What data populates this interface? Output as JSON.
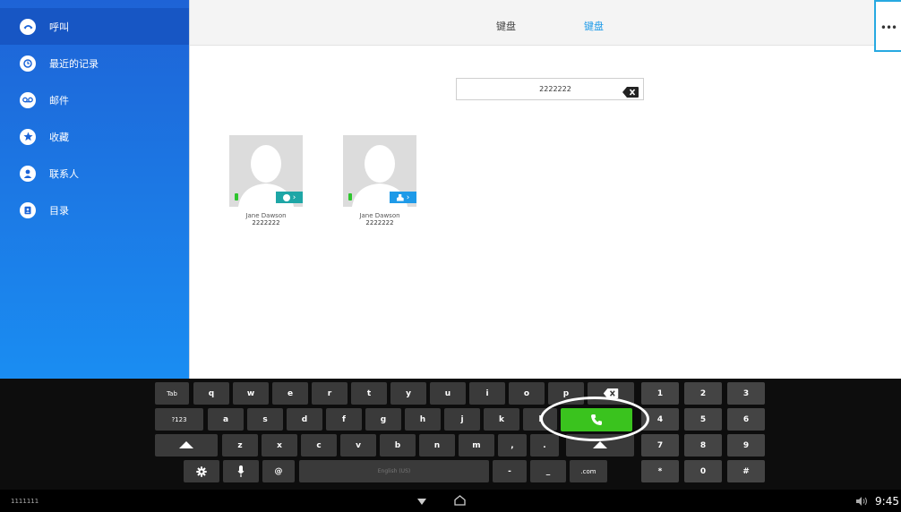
{
  "sidebar": {
    "items": [
      {
        "label": "呼叫",
        "icon": "phone-icon",
        "active": true
      },
      {
        "label": "最近的记录",
        "icon": "clock-icon"
      },
      {
        "label": "邮件",
        "icon": "voicemail-icon"
      },
      {
        "label": "收藏",
        "icon": "star-icon"
      },
      {
        "label": "联系人",
        "icon": "person-icon"
      },
      {
        "label": "目录",
        "icon": "directory-icon"
      }
    ]
  },
  "header": {
    "tabs": [
      {
        "label": "键盘"
      },
      {
        "label": "键盘",
        "active": true
      }
    ],
    "more_label": "•••",
    "accent_color": "#1e9ae8"
  },
  "search": {
    "value": "2222222"
  },
  "contacts": [
    {
      "name": "Jane Dawson",
      "number": "2222222",
      "action_icon": "video-icon"
    },
    {
      "name": "Jane Dawson",
      "number": "2222222",
      "action_icon": "contact-card-icon"
    }
  ],
  "keyboard": {
    "row1": [
      "Tab",
      "q",
      "w",
      "e",
      "r",
      "t",
      "y",
      "u",
      "i",
      "o",
      "p"
    ],
    "row2": [
      "?123",
      "a",
      "s",
      "d",
      "f",
      "g",
      "h",
      "j",
      "k",
      "l"
    ],
    "row3": [
      "z",
      "x",
      "c",
      "v",
      "b",
      "n",
      "m",
      ",",
      "."
    ],
    "row4": [
      "@",
      "English (US)",
      "-",
      "_",
      ".com"
    ],
    "call_color": "#3ac31e"
  },
  "numpad": {
    "keys": [
      "1",
      "2",
      "3",
      "4",
      "5",
      "6",
      "7",
      "8",
      "9",
      "*",
      "0",
      "#"
    ]
  },
  "system_bar": {
    "left_text": "1111111",
    "time": "9:45"
  }
}
